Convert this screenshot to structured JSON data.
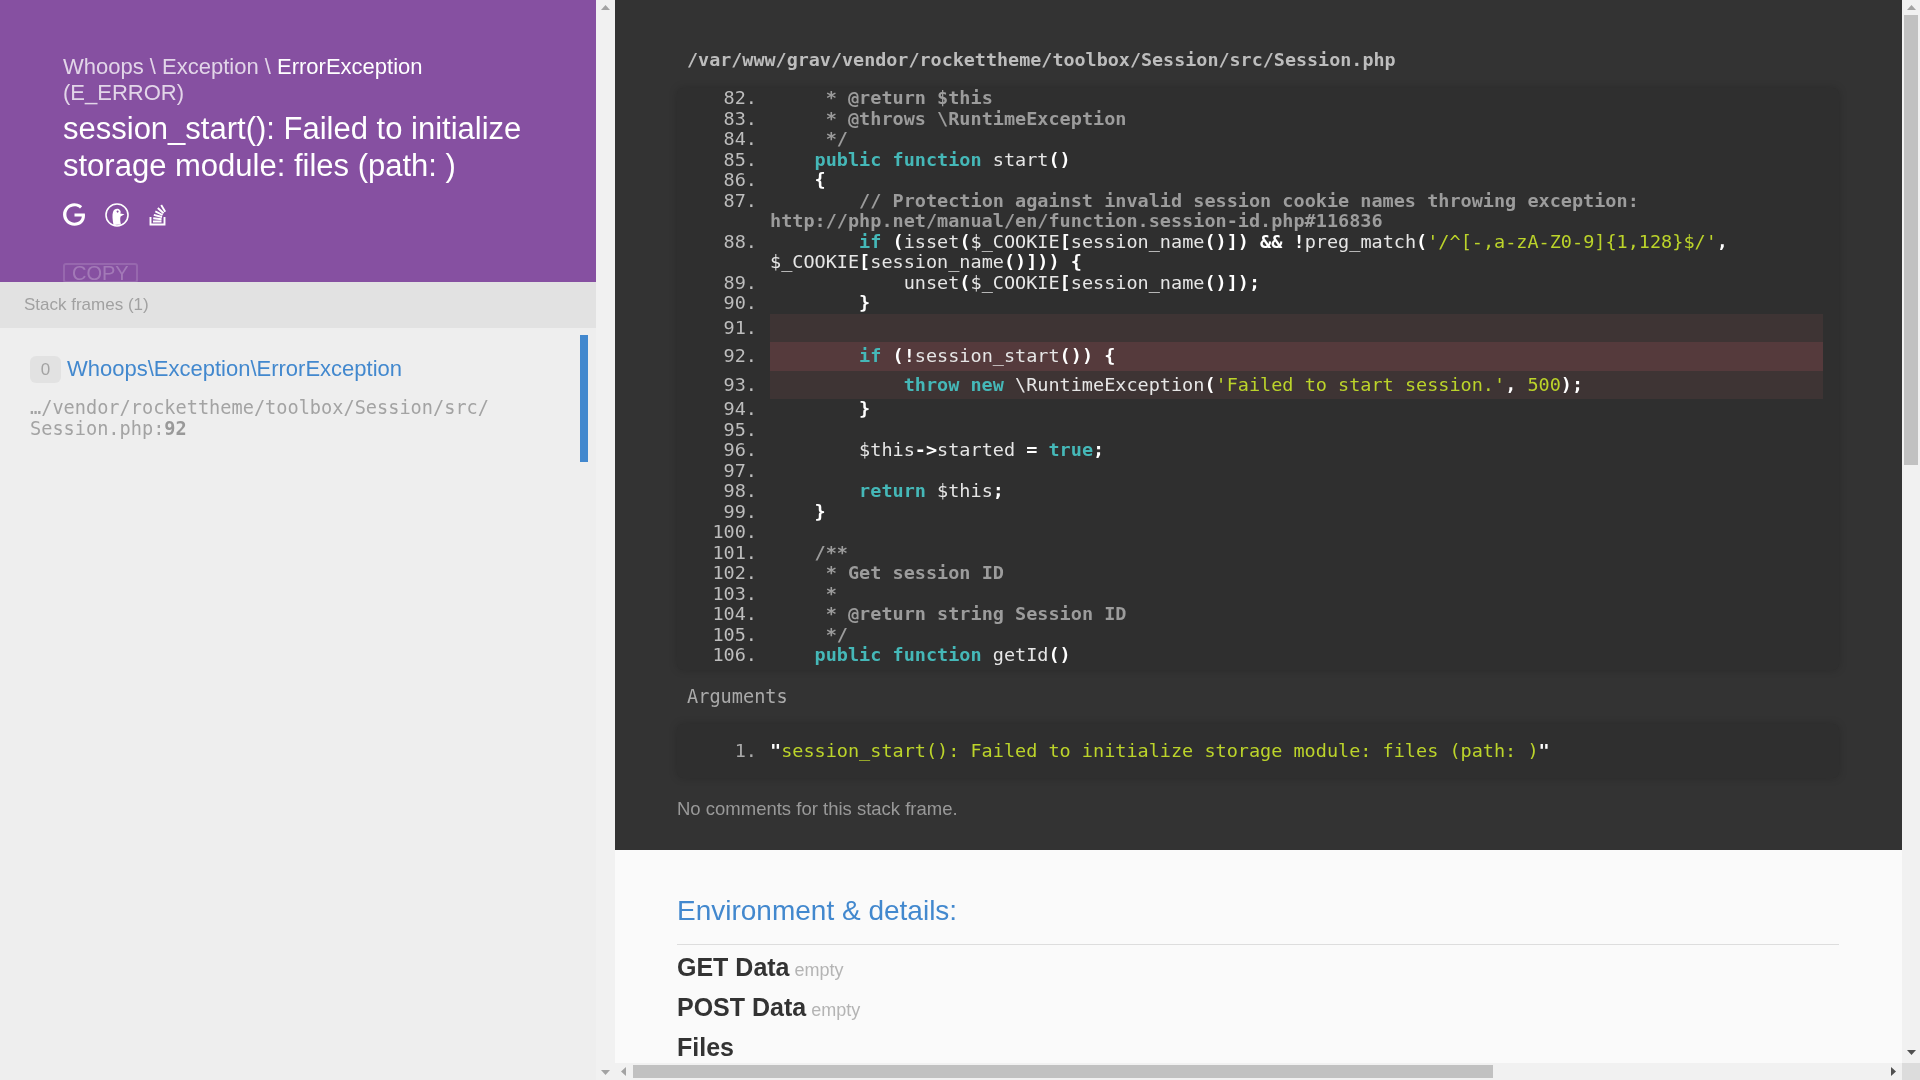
{
  "header": {
    "namespace": "Whoops \\ Exception \\",
    "class_name": "ErrorException",
    "error_code": "(E_ERROR)",
    "message": "session_start(): Failed to initialize storage module: files (path: )",
    "copy_button": "COPY"
  },
  "stack_frames": {
    "title": "Stack frames (1)",
    "frames": [
      {
        "index": "0",
        "class_name": "Whoops\\Exception\\ErrorException",
        "file": "…/vendor/rockettheme/toolbox/Session/src/Session.php:**92**",
        "selected": true
      }
    ]
  },
  "code_view": {
    "file_path": "/var/www/grav/vendor/rockettheme/toolbox/Session/src/Session.php",
    "lines": [
      {
        "number": "82.",
        "tokens": [
          {
            "kind": "comment",
            "text": "     * @return $this"
          }
        ],
        "highlighted": false,
        "current": false
      },
      {
        "number": "83.",
        "tokens": [
          {
            "kind": "comment",
            "text": "     * @throws \\RuntimeException"
          }
        ],
        "highlighted": false,
        "current": false
      },
      {
        "number": "84.",
        "tokens": [
          {
            "kind": "comment",
            "text": "     */"
          }
        ],
        "highlighted": false,
        "current": false
      },
      {
        "number": "85.",
        "tokens": [
          {
            "kind": "keyword",
            "text": "    public function"
          },
          {
            "kind": "plain",
            "text": " start"
          },
          {
            "kind": "punct",
            "text": "()"
          }
        ],
        "highlighted": false,
        "current": false
      },
      {
        "number": "86.",
        "tokens": [
          {
            "kind": "punct",
            "text": "    {"
          }
        ],
        "highlighted": false,
        "current": false
      },
      {
        "number": "87.",
        "tokens": [
          {
            "kind": "comment",
            "text": "        // Protection against invalid session cookie names throwing exception: http://php.net/manual/en/function.session-id.php#116836"
          }
        ],
        "highlighted": false,
        "current": false
      },
      {
        "number": "88.",
        "tokens": [
          {
            "kind": "keyword",
            "text": "        if"
          },
          {
            "kind": "punct",
            "text": " ("
          },
          {
            "kind": "plain",
            "text": "isset"
          },
          {
            "kind": "punct",
            "text": "("
          },
          {
            "kind": "plain",
            "text": "$_COOKIE"
          },
          {
            "kind": "punct",
            "text": "["
          },
          {
            "kind": "plain",
            "text": "session_name"
          },
          {
            "kind": "punct",
            "text": "()])"
          },
          {
            "kind": "punct",
            "text": " && !"
          },
          {
            "kind": "plain",
            "text": "preg_match"
          },
          {
            "kind": "punct",
            "text": "("
          },
          {
            "kind": "string",
            "text": "'/^[-,a-zA-Z0-9]{1,128}$/'"
          },
          {
            "kind": "punct",
            "text": ", "
          },
          {
            "kind": "plain",
            "text": "$_COOKIE"
          },
          {
            "kind": "punct",
            "text": "["
          },
          {
            "kind": "plain",
            "text": "session_name"
          },
          {
            "kind": "punct",
            "text": "()]))"
          },
          {
            "kind": "punct",
            "text": " {"
          }
        ],
        "highlighted": false,
        "current": false
      },
      {
        "number": "89.",
        "tokens": [
          {
            "kind": "plain",
            "text": "            unset"
          },
          {
            "kind": "punct",
            "text": "("
          },
          {
            "kind": "plain",
            "text": "$_COOKIE"
          },
          {
            "kind": "punct",
            "text": "["
          },
          {
            "kind": "plain",
            "text": "session_name"
          },
          {
            "kind": "punct",
            "text": "()]);"
          }
        ],
        "highlighted": false,
        "current": false
      },
      {
        "number": "90.",
        "tokens": [
          {
            "kind": "punct",
            "text": "        }"
          }
        ],
        "highlighted": false,
        "current": false
      },
      {
        "number": "91.",
        "highlighted": true,
        "current": false
      },
      {
        "number": "92.",
        "tokens": [
          {
            "kind": "keyword",
            "text": "        if"
          },
          {
            "kind": "punct",
            "text": " (!"
          },
          {
            "kind": "plain",
            "text": "session_start"
          },
          {
            "kind": "punct",
            "text": "()) {"
          }
        ],
        "highlighted": true,
        "current": true
      },
      {
        "number": "93.",
        "tokens": [
          {
            "kind": "keyword",
            "text": "            throw new"
          },
          {
            "kind": "plain",
            "text": " \\RuntimeException"
          },
          {
            "kind": "punct",
            "text": "("
          },
          {
            "kind": "string",
            "text": "'Failed to start session.'"
          },
          {
            "kind": "punct",
            "text": ", "
          },
          {
            "kind": "number",
            "text": "500"
          },
          {
            "kind": "punct",
            "text": ");"
          }
        ],
        "highlighted": true,
        "current": false
      },
      {
        "number": "94.",
        "tokens": [
          {
            "kind": "punct",
            "text": "        }"
          }
        ],
        "highlighted": false,
        "current": false
      },
      {
        "number": "95.",
        "highlighted": false,
        "current": false
      },
      {
        "number": "96.",
        "tokens": [
          {
            "kind": "plain",
            "text": "        $this"
          },
          {
            "kind": "punct",
            "text": "->"
          },
          {
            "kind": "plain",
            "text": "started "
          },
          {
            "kind": "punct",
            "text": "= "
          },
          {
            "kind": "keyword",
            "text": "true"
          },
          {
            "kind": "punct",
            "text": ";"
          }
        ],
        "highlighted": false,
        "current": false
      },
      {
        "number": "97.",
        "highlighted": false,
        "current": false
      },
      {
        "number": "98.",
        "tokens": [
          {
            "kind": "keyword",
            "text": "        return"
          },
          {
            "kind": "plain",
            "text": " $this"
          },
          {
            "kind": "punct",
            "text": ";"
          }
        ],
        "highlighted": false,
        "current": false
      },
      {
        "number": "99.",
        "tokens": [
          {
            "kind": "punct",
            "text": "    }"
          }
        ],
        "highlighted": false,
        "current": false
      },
      {
        "number": "100.",
        "highlighted": false,
        "current": false
      },
      {
        "number": "101.",
        "tokens": [
          {
            "kind": "comment",
            "text": "    /**"
          }
        ],
        "highlighted": false,
        "current": false
      },
      {
        "number": "102.",
        "tokens": [
          {
            "kind": "comment",
            "text": "     * Get session ID"
          }
        ],
        "highlighted": false,
        "current": false
      },
      {
        "number": "103.",
        "tokens": [
          {
            "kind": "comment",
            "text": "     *"
          }
        ],
        "highlighted": false,
        "current": false
      },
      {
        "number": "104.",
        "tokens": [
          {
            "kind": "comment",
            "text": "     * @return string Session ID"
          }
        ],
        "highlighted": false,
        "current": false
      },
      {
        "number": "105.",
        "tokens": [
          {
            "kind": "comment",
            "text": "     */"
          }
        ],
        "highlighted": false,
        "current": false
      },
      {
        "number": "106.",
        "tokens": [
          {
            "kind": "keyword",
            "text": "    public function"
          },
          {
            "kind": "plain",
            "text": " getId"
          },
          {
            "kind": "punct",
            "text": "()"
          }
        ],
        "highlighted": false,
        "current": false
      }
    ]
  },
  "arguments": {
    "title": "Arguments",
    "items": [
      {
        "number": "1.",
        "tokens": [
          {
            "kind": "punct",
            "text": "\""
          },
          {
            "kind": "string",
            "text": "session_start(): Failed to initialize storage module: files (path: )"
          },
          {
            "kind": "punct",
            "text": "\""
          }
        ]
      }
    ]
  },
  "comments_note": "No comments for this stack frame.",
  "environment": {
    "title": "Environment & details:",
    "sections": [
      {
        "title": "GET Data",
        "note": "empty"
      },
      {
        "title": "POST Data",
        "note": "empty"
      },
      {
        "title": "Files"
      }
    ]
  }
}
